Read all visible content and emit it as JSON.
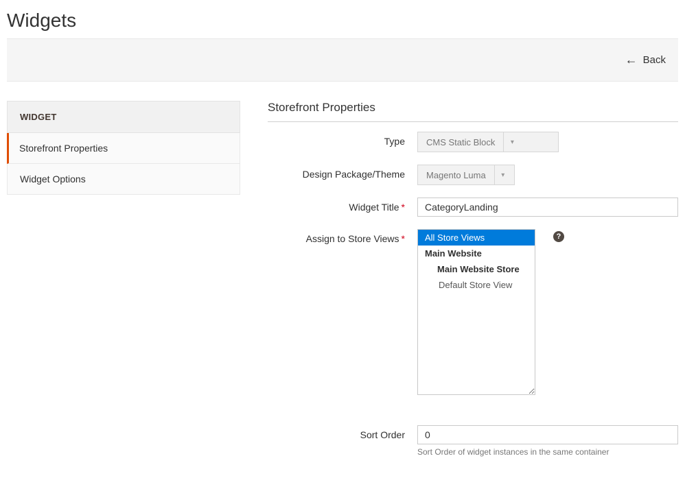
{
  "pageTitle": "Widgets",
  "back": {
    "label": "Back"
  },
  "sidebar": {
    "heading": "WIDGET",
    "items": [
      {
        "label": "Storefront Properties",
        "active": true
      },
      {
        "label": "Widget Options",
        "active": false
      }
    ]
  },
  "section": {
    "title": "Storefront Properties"
  },
  "fields": {
    "type": {
      "label": "Type",
      "value": "CMS Static Block"
    },
    "theme": {
      "label": "Design Package/Theme",
      "value": "Magento Luma"
    },
    "title": {
      "label": "Widget Title",
      "value": "CategoryLanding"
    },
    "stores": {
      "label": "Assign to Store Views",
      "options": {
        "all": "All Store Views",
        "site": "Main Website",
        "store": "Main Website Store",
        "view": "Default Store View"
      }
    },
    "sortOrder": {
      "label": "Sort Order",
      "value": "0",
      "hint": "Sort Order of widget instances in the same container"
    }
  }
}
